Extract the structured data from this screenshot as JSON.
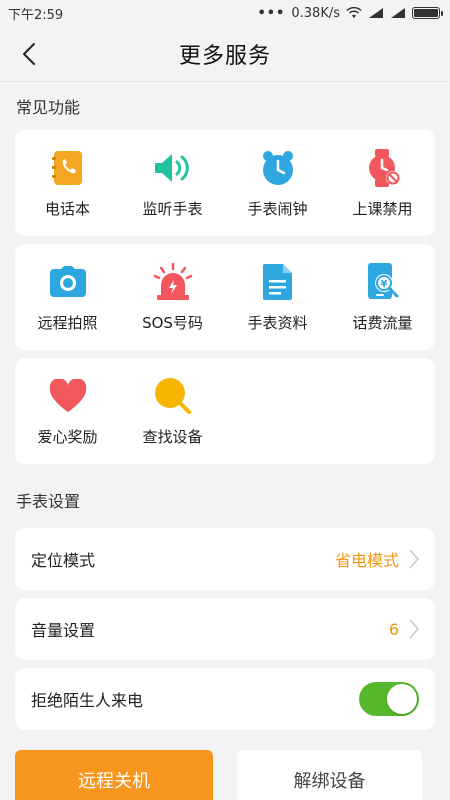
{
  "status": {
    "time": "下午2:59",
    "dots": "•••",
    "speed": "0.38K/s"
  },
  "header": {
    "title": "更多服务"
  },
  "common": {
    "title": "常见功能",
    "items": [
      {
        "label": "电话本",
        "icon": "phonebook-icon",
        "color": "#f5a623"
      },
      {
        "label": "监听手表",
        "icon": "speaker-icon",
        "color": "#22c3a0"
      },
      {
        "label": "手表闹钟",
        "icon": "alarm-clock-icon",
        "color": "#2ea7e0"
      },
      {
        "label": "上课禁用",
        "icon": "watch-disabled-icon",
        "color": "#f2575d"
      },
      {
        "label": "远程拍照",
        "icon": "camera-icon",
        "color": "#2ea7e0"
      },
      {
        "label": "SOS号码",
        "icon": "sos-alarm-icon",
        "color": "#f2575d"
      },
      {
        "label": "手表资料",
        "icon": "document-icon",
        "color": "#2ea7e0"
      },
      {
        "label": "话费流量",
        "icon": "phone-balance-icon",
        "color": "#2ea7e0"
      },
      {
        "label": "爱心奖励",
        "icon": "heart-icon",
        "color": "#f2575d"
      },
      {
        "label": "查找设备",
        "icon": "find-device-icon",
        "color": "#f7b500"
      }
    ]
  },
  "settings": {
    "title": "手表设置",
    "location_mode": {
      "label": "定位模式",
      "value": "省电模式"
    },
    "volume": {
      "label": "音量设置",
      "value": "6"
    },
    "reject_strangers": {
      "label": "拒绝陌生人来电",
      "enabled": true
    }
  },
  "actions": {
    "shutdown": "远程关机",
    "unbind": "解绑设备"
  },
  "colors": {
    "accent": "#f7951d",
    "value": "#f29611",
    "toggle_on": "#55b82b"
  }
}
